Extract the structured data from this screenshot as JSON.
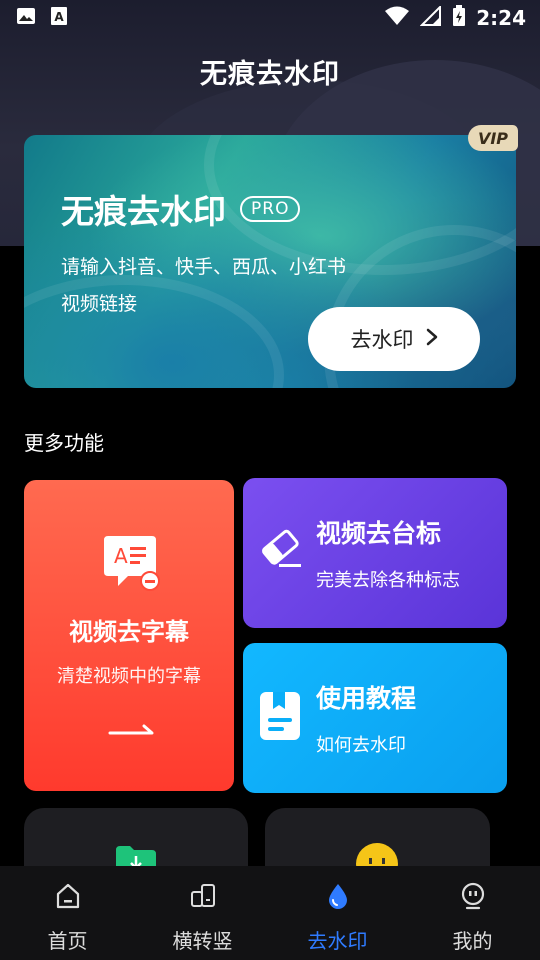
{
  "status_bar": {
    "time": "2:24",
    "icons": [
      "image-icon",
      "text-a-icon",
      "wifi-icon",
      "signal-icon",
      "battery-charging-icon"
    ]
  },
  "header": {
    "title": "无痕去水印"
  },
  "banner": {
    "vip_badge": "VIP",
    "title": "无痕去水印",
    "pro_label": "PRO",
    "description": "请输入抖音、快手、西瓜、小红书视频链接",
    "button_label": "去水印"
  },
  "more_features": {
    "title": "更多功能",
    "cards": [
      {
        "title": "视频去字幕",
        "subtitle": "清楚视频中的字幕",
        "color": "#ff4a38",
        "icon": "subtitle-remove-icon"
      },
      {
        "title": "视频去台标",
        "subtitle": "完美去除各种标志",
        "color": "#6a40e8",
        "icon": "eraser-icon"
      },
      {
        "title": "使用教程",
        "subtitle": "如何去水印",
        "color": "#0aaef8",
        "icon": "bookmark-note-icon"
      }
    ]
  },
  "tabbar": {
    "tabs": [
      {
        "label": "首页",
        "icon": "home-icon",
        "active": false
      },
      {
        "label": "横转竖",
        "icon": "rotate-screen-icon",
        "active": false
      },
      {
        "label": "去水印",
        "icon": "water-drop-icon",
        "active": true
      },
      {
        "label": "我的",
        "icon": "profile-icon",
        "active": false
      }
    ],
    "active_color": "#2f7bff"
  }
}
